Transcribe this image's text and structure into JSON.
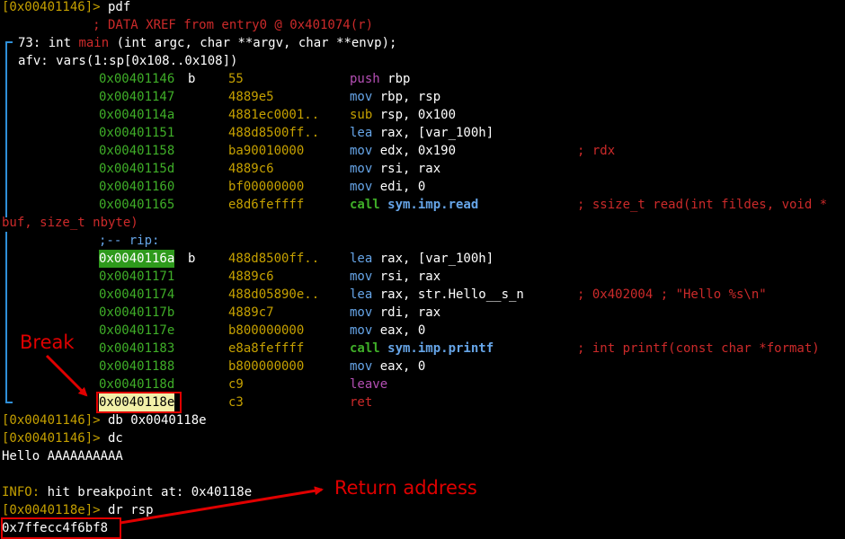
{
  "header": {
    "prompt": "[0x00401146]>",
    "command": " pdf",
    "xref": "            ; DATA XREF from entry0 @ 0x401074(r)",
    "sig_num": "73: int ",
    "sig_func": "main",
    "sig_rest": " (int argc, char **argv, char **envp);",
    "afv": "afv: vars(1:sp[0x108..0x108])"
  },
  "block1": [
    {
      "addr": "0x00401146",
      "flag": "b",
      "bytes": "55",
      "mnem": "push",
      "ops": "rbp",
      "mclass": "purple",
      "comment": ""
    },
    {
      "addr": "0x00401147",
      "flag": "",
      "bytes": "4889e5",
      "mnem": "mov",
      "ops": "rbp, rsp",
      "mclass": "blue",
      "comment": ""
    },
    {
      "addr": "0x0040114a",
      "flag": "",
      "bytes": "4881ec0001..",
      "mnem": "sub",
      "ops": "rsp, 0x100",
      "mclass": "gold",
      "comment": ""
    },
    {
      "addr": "0x00401151",
      "flag": "",
      "bytes": "488d8500ff..",
      "mnem": "lea",
      "ops": "rax, [var_100h]",
      "mclass": "blue",
      "comment": ""
    },
    {
      "addr": "0x00401158",
      "flag": "",
      "bytes": "ba90010000",
      "mnem": "mov",
      "ops": "edx, 0x190",
      "mclass": "blue",
      "comment": "; rdx"
    },
    {
      "addr": "0x0040115d",
      "flag": "",
      "bytes": "4889c6",
      "mnem": "mov",
      "ops": "rsi, rax",
      "mclass": "blue",
      "comment": ""
    },
    {
      "addr": "0x00401160",
      "flag": "",
      "bytes": "bf00000000",
      "mnem": "mov",
      "ops": "edi, 0",
      "mclass": "blue",
      "comment": ""
    },
    {
      "addr": "0x00401165",
      "flag": "",
      "bytes": "e8d6feffff",
      "mnem": "call",
      "ops": "sym.imp.read",
      "mclass": "green",
      "comment": "; ssize_t read(int fildes, void *"
    }
  ],
  "wrap_comment": "buf, size_t nbyte)",
  "rip_label": ";-- rip:",
  "block2": [
    {
      "addr": "0x0040116a",
      "flag": "b",
      "bytes": "488d8500ff..",
      "mnem": "lea",
      "ops": "rax, [var_100h]",
      "mclass": "blue",
      "comment": "",
      "hl": "green"
    },
    {
      "addr": "0x00401171",
      "flag": "",
      "bytes": "4889c6",
      "mnem": "mov",
      "ops": "rsi, rax",
      "mclass": "blue",
      "comment": ""
    },
    {
      "addr": "0x00401174",
      "flag": "",
      "bytes": "488d05890e..",
      "mnem": "lea",
      "ops": "rax, str.Hello__s_n",
      "mclass": "blue",
      "comment": "; 0x402004 ; \"Hello %s\\n\""
    },
    {
      "addr": "0x0040117b",
      "flag": "",
      "bytes": "4889c7",
      "mnem": "mov",
      "ops": "rdi, rax",
      "mclass": "blue",
      "comment": ""
    },
    {
      "addr": "0x0040117e",
      "flag": "",
      "bytes": "b800000000",
      "mnem": "mov",
      "ops": "eax, 0",
      "mclass": "blue",
      "comment": ""
    },
    {
      "addr": "0x00401183",
      "flag": "",
      "bytes": "e8a8feffff",
      "mnem": "call",
      "ops": "sym.imp.printf",
      "mclass": "green",
      "comment": "; int printf(const char *format)"
    },
    {
      "addr": "0x00401188",
      "flag": "",
      "bytes": "b800000000",
      "mnem": "mov",
      "ops": "eax, 0",
      "mclass": "blue",
      "comment": ""
    },
    {
      "addr": "0x0040118d",
      "flag": "",
      "bytes": "c9",
      "mnem": "leave",
      "ops": "",
      "mclass": "purple",
      "comment": ""
    },
    {
      "addr": "0x0040118e",
      "flag": "",
      "bytes": "c3",
      "mnem": "ret",
      "ops": "",
      "mclass": "red",
      "comment": "",
      "hl": "yellow"
    }
  ],
  "session": [
    {
      "prompt": "[0x00401146]>",
      "text": " db 0x0040118e"
    },
    {
      "prompt": "[0x00401146]>",
      "text": " dc"
    },
    {
      "prompt": "",
      "text": "Hello AAAAAAAAAA"
    },
    {
      "prompt": "",
      "text": ""
    },
    {
      "prompt": "INFO:",
      "text": " hit breakpoint at: 0x40118e"
    },
    {
      "prompt": "[0x0040118e]>",
      "text": " dr rsp"
    },
    {
      "prompt": "",
      "text": "0x7ffecc4f6bf8"
    }
  ],
  "annotations": {
    "break_label": "Break",
    "return_label": "Return address",
    "color": "#e00000"
  }
}
